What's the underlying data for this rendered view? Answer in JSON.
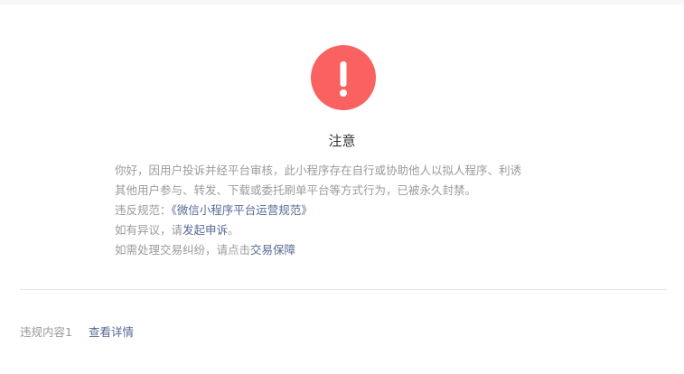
{
  "notice": {
    "title": "注意",
    "icon": "exclamation-icon",
    "icon_color": "#fa6262",
    "message_line1": "你好，因用户投诉并经平台审核，此小程序存在自行或协助他人以拟人程序、利诱",
    "message_line2": "其他用户参与、转发、下载或委托刷单平台等方式行为，已被永久封禁。",
    "rule_prefix": "违反规范：",
    "rule_link": "《微信小程序平台运营规范》",
    "appeal_prefix": "如有异议，请",
    "appeal_link": "发起申诉",
    "appeal_suffix": "。",
    "dispute_prefix": "如需处理交易纠纷，请点击",
    "dispute_link": "交易保障",
    "link_color": "#576b95"
  },
  "footer": {
    "violation_label": "违规内容1",
    "detail_link": "查看详情"
  }
}
